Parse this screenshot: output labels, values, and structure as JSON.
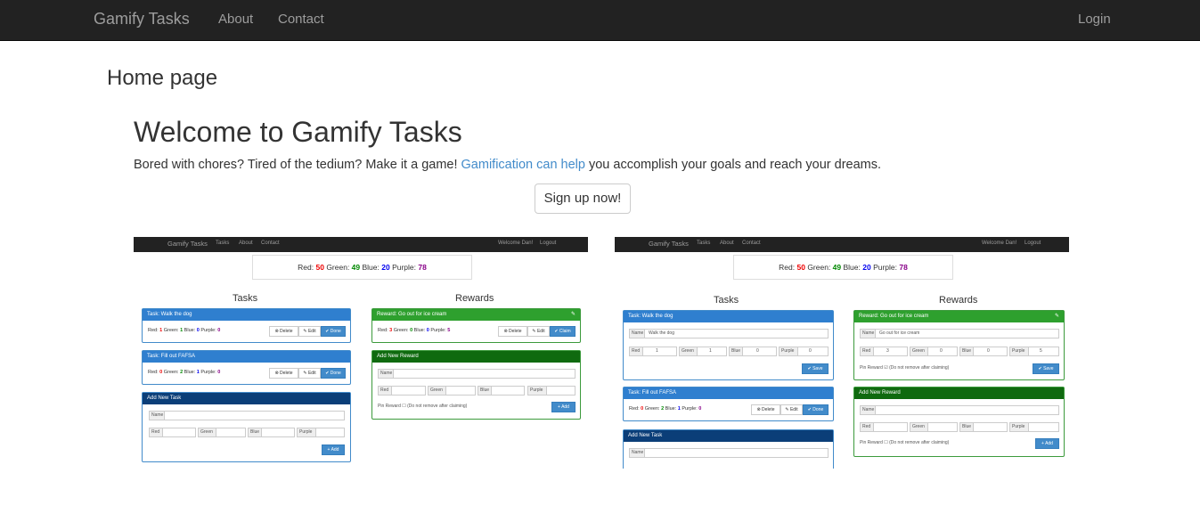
{
  "nav": {
    "brand": "Gamify Tasks",
    "about": "About",
    "contact": "Contact",
    "login": "Login"
  },
  "page": {
    "title": "Home page",
    "heading": "Welcome to Gamify Tasks",
    "lead_before": "Bored with chores? Tired of the tedium? Make it a game! ",
    "lead_link": "Gamification can help",
    "lead_after": " you accomplish your goals and reach your dreams.",
    "signup": "Sign up now!"
  },
  "shot": {
    "brand": "Gamify Tasks",
    "tasks": "Tasks",
    "about": "About",
    "contact": "Contact",
    "welcome": "Welcome Dan!",
    "logout": "Logout",
    "score_red_label": "Red: ",
    "score_red": "50",
    "score_green_label": " Green: ",
    "score_green": "49",
    "score_blue_label": " Blue: ",
    "score_blue": "20",
    "score_purple_label": " Purple: ",
    "score_purple": "78",
    "tasks_header": "Tasks",
    "rewards_header": "Rewards",
    "task1": "Task: Walk the dog",
    "task1_stats": [
      "Red: ",
      "1",
      " Green: ",
      "1",
      " Blue: ",
      "0",
      " Purple: ",
      "0"
    ],
    "task2": "Task: Fill out FAFSA",
    "task2_stats": [
      "Red: ",
      "0",
      " Green: ",
      "2",
      " Blue: ",
      "1",
      " Purple: ",
      "0"
    ],
    "add_task": "Add New Task",
    "reward1": "Reward: Go out for ice cream",
    "reward1_stats": [
      "Red: ",
      "3",
      " Green: ",
      "0",
      " Blue: ",
      "0",
      " Purple: ",
      "5"
    ],
    "add_reward": "Add New Reward",
    "btn_delete": "⊗ Delete",
    "btn_edit": "✎ Edit",
    "btn_done": "✔ Done",
    "btn_claim": "✔ Claim",
    "btn_add": "+ Add",
    "btn_save": "✔ Save",
    "lbl_name": "Name",
    "lbl_red": "Red",
    "lbl_green": "Green",
    "lbl_blue": "Blue",
    "lbl_purple": "Purple",
    "pin_reward": "Pin Reward ☐ (Do not remove after claiming)",
    "pin_reward_checked": "Pin Reward ☑ (Do not remove after claiming)",
    "edit_task_name": "Walk the dog",
    "edit_task_red": "1",
    "edit_task_green": "1",
    "edit_task_blue": "0",
    "edit_task_purple": "0",
    "edit_reward_name": "Go out for ice cream",
    "edit_reward_red": "3",
    "edit_reward_green": "0",
    "edit_reward_blue": "0",
    "edit_reward_purple": "5",
    "pin_icon": "pin-icon"
  }
}
